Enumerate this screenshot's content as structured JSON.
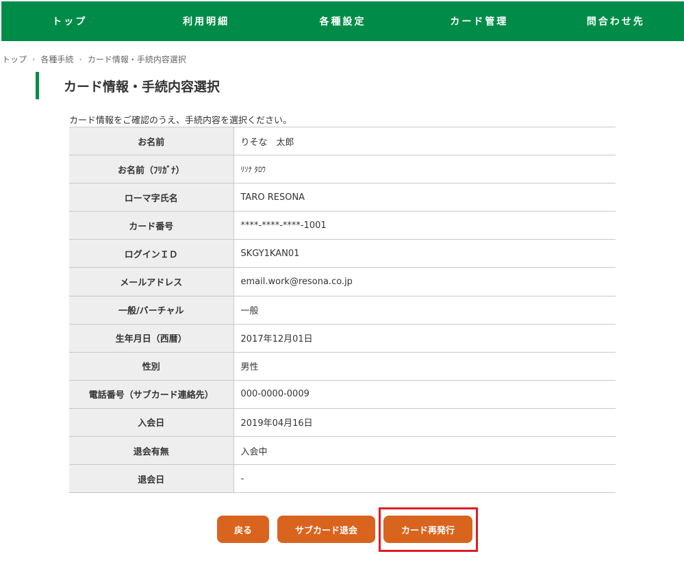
{
  "nav": {
    "items": [
      {
        "label": "トップ"
      },
      {
        "label": "利用明細"
      },
      {
        "label": "各種設定"
      },
      {
        "label": "カード管理"
      },
      {
        "label": "問合わせ先"
      }
    ]
  },
  "breadcrumb": {
    "items": [
      {
        "label": "トップ"
      },
      {
        "label": "各種手続"
      },
      {
        "label": "カード情報・手続内容選択"
      }
    ],
    "separator": "›"
  },
  "page": {
    "title": "カード情報・手続内容選択",
    "instruction": "カード情報をご確認のうえ、手続内容を選択ください。"
  },
  "card_info": {
    "rows": [
      {
        "label": "お名前",
        "value": "りそな　太郎"
      },
      {
        "label": "お名前（ﾌﾘｶﾞﾅ）",
        "value": "ﾘｿﾅ ﾀﾛｳ"
      },
      {
        "label": "ローマ字氏名",
        "value": "TARO RESONA"
      },
      {
        "label": "カード番号",
        "value": "****-****-****-1001"
      },
      {
        "label": "ログインＩＤ",
        "value": "SKGY1KAN01"
      },
      {
        "label": "メールアドレス",
        "value": "email.work@resona.co.jp"
      },
      {
        "label": "一般/バーチャル",
        "value": "一般"
      },
      {
        "label": "生年月日（西暦）",
        "value": "2017年12月01日"
      },
      {
        "label": "性別",
        "value": "男性"
      },
      {
        "label": "電話番号（サブカード連絡先）",
        "value": "000-0000-0009"
      },
      {
        "label": "入会日",
        "value": "2019年04月16日"
      },
      {
        "label": "退会有無",
        "value": "入会中"
      },
      {
        "label": "退会日",
        "value": "-"
      }
    ]
  },
  "actions": {
    "back_label": "戻る",
    "sub_card_withdraw_label": "サブカード退会",
    "reissue_label": "カード再発行"
  },
  "colors": {
    "nav_bg": "#008c48",
    "button_bg": "#d9641e",
    "highlight": "#e01b24",
    "label_bg": "#eeeeee"
  }
}
